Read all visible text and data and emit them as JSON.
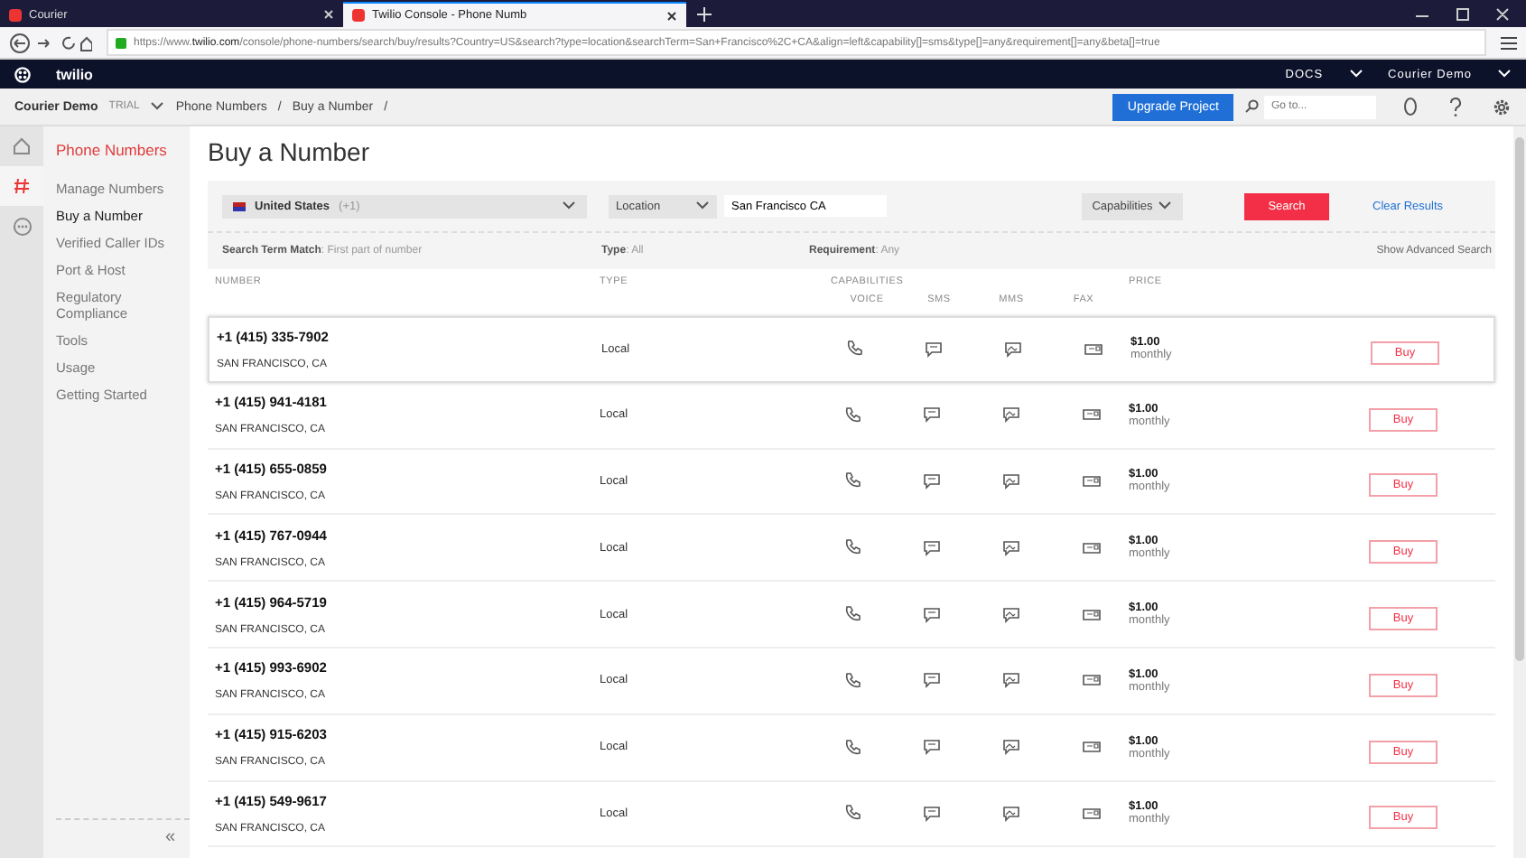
{
  "browser": {
    "tabs": [
      {
        "title": "Courier",
        "selected": false
      },
      {
        "title": "Twilio Console - Phone Numb",
        "selected": true
      }
    ],
    "url_prefix": "https://www.",
    "url_host": "twilio.com",
    "url_path": "/console/phone-numbers/search/buy/results?Country=US&search?type=location&searchTerm=San+Francisco%2C+CA&align=left&capability[]=sms&type[]=any&requirement[]=any&beta[]=true"
  },
  "header": {
    "logo": "twilio",
    "docs": "DOCS",
    "account": "Courier Demo"
  },
  "subheader": {
    "project": "Courier Demo",
    "badge": "TRIAL",
    "breadcrumbs": [
      "Phone Numbers",
      "/",
      "Buy a Number",
      "/"
    ],
    "upgrade": "Upgrade Project",
    "search_placeholder": "Go to..."
  },
  "rail": [
    {
      "selected": false
    },
    {
      "selected": true
    },
    {
      "selected": false
    }
  ],
  "sidebar": {
    "title": "Phone Numbers",
    "items": [
      {
        "label": "Manage Numbers",
        "selected": false
      },
      {
        "label": "Buy a Number",
        "selected": true
      },
      {
        "label": "Verified Caller IDs",
        "selected": false
      },
      {
        "label": "Port & Host",
        "selected": false
      },
      {
        "label": "Regulatory Compliance",
        "selected": false
      },
      {
        "label": "Tools",
        "selected": false
      },
      {
        "label": "Usage",
        "selected": false
      },
      {
        "label": "Getting Started",
        "selected": false
      }
    ],
    "collapse": "«"
  },
  "page_title": "Buy a Number",
  "search": {
    "country": "United States",
    "country_code": "(+1)",
    "type": "Location",
    "term": "San Francisco CA",
    "capabilities": "Capabilities",
    "search_button": "Search",
    "clear": "Clear Results",
    "filters": [
      "**Search Term Match**: First part of number",
      "**Type**: All",
      "**Requirement**: Any"
    ],
    "advanced": "Show Advanced Search"
  },
  "table": {
    "columns": [
      "NUMBER",
      "TYPE",
      "CAPABILITIES",
      "PRICE"
    ],
    "capabilities": [
      "VOICE",
      "SMS",
      "MMS",
      "FAX"
    ],
    "rows": [
      {
        "number": "+1 (415) 335-7902",
        "location": "SAN FRANCISCO, CA",
        "type": "Local",
        "price": "$1.00",
        "period": "monthly",
        "action": "Buy",
        "selected": true
      },
      {
        "number": "+1 (415) 941-4181",
        "location": "SAN FRANCISCO, CA",
        "type": "Local",
        "price": "$1.00",
        "period": "monthly",
        "action": "Buy",
        "selected": false
      },
      {
        "number": "+1 (415) 655-0859",
        "location": "SAN FRANCISCO, CA",
        "type": "Local",
        "price": "$1.00",
        "period": "monthly",
        "action": "Buy",
        "selected": false
      },
      {
        "number": "+1 (415) 767-0944",
        "location": "SAN FRANCISCO, CA",
        "type": "Local",
        "price": "$1.00",
        "period": "monthly",
        "action": "Buy",
        "selected": false
      },
      {
        "number": "+1 (415) 964-5719",
        "location": "SAN FRANCISCO, CA",
        "type": "Local",
        "price": "$1.00",
        "period": "monthly",
        "action": "Buy",
        "selected": false
      },
      {
        "number": "+1 (415) 993-6902",
        "location": "SAN FRANCISCO, CA",
        "type": "Local",
        "price": "$1.00",
        "period": "monthly",
        "action": "Buy",
        "selected": false
      },
      {
        "number": "+1 (415) 915-6203",
        "location": "SAN FRANCISCO, CA",
        "type": "Local",
        "price": "$1.00",
        "period": "monthly",
        "action": "Buy",
        "selected": false
      },
      {
        "number": "+1 (415) 549-9617",
        "location": "SAN FRANCISCO, CA",
        "type": "Local",
        "price": "$1.00",
        "period": "monthly",
        "action": "Buy",
        "selected": false
      }
    ]
  }
}
